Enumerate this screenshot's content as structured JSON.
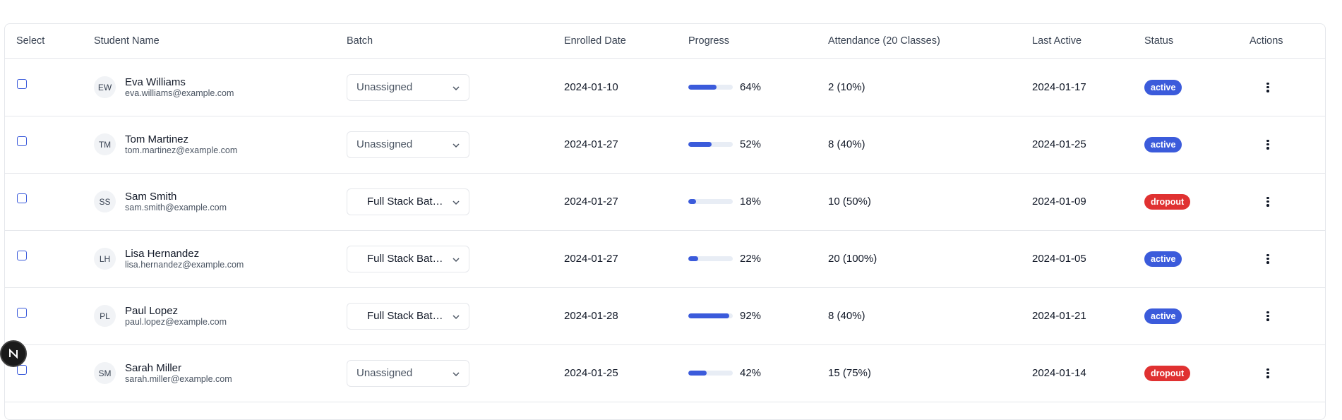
{
  "headers": {
    "select": "Select",
    "student_name": "Student Name",
    "batch": "Batch",
    "enrolled_date": "Enrolled Date",
    "progress": "Progress",
    "attendance": "Attendance (20 Classes)",
    "last_active": "Last Active",
    "status": "Status",
    "actions": "Actions"
  },
  "rows": [
    {
      "initials": "EW",
      "name": "Eva Williams",
      "email": "eva.williams@example.com",
      "batch": "Unassigned",
      "enrolled": "2024-01-10",
      "progress": 64,
      "progress_label": "64%",
      "attendance": "2 (10%)",
      "last_active": "2024-01-17",
      "status": "active"
    },
    {
      "initials": "TM",
      "name": "Tom Martinez",
      "email": "tom.martinez@example.com",
      "batch": "Unassigned",
      "enrolled": "2024-01-27",
      "progress": 52,
      "progress_label": "52%",
      "attendance": "8 (40%)",
      "last_active": "2024-01-25",
      "status": "active"
    },
    {
      "initials": "SS",
      "name": "Sam Smith",
      "email": "sam.smith@example.com",
      "batch": "Full Stack Batch...",
      "enrolled": "2024-01-27",
      "progress": 18,
      "progress_label": "18%",
      "attendance": "10 (50%)",
      "last_active": "2024-01-09",
      "status": "dropout"
    },
    {
      "initials": "LH",
      "name": "Lisa Hernandez",
      "email": "lisa.hernandez@example.com",
      "batch": "Full Stack Batch...",
      "enrolled": "2024-01-27",
      "progress": 22,
      "progress_label": "22%",
      "attendance": "20 (100%)",
      "last_active": "2024-01-05",
      "status": "active"
    },
    {
      "initials": "PL",
      "name": "Paul Lopez",
      "email": "paul.lopez@example.com",
      "batch": "Full Stack Batch...",
      "enrolled": "2024-01-28",
      "progress": 92,
      "progress_label": "92%",
      "attendance": "8 (40%)",
      "last_active": "2024-01-21",
      "status": "active"
    },
    {
      "initials": "SM",
      "name": "Sarah Miller",
      "email": "sarah.miller@example.com",
      "batch": "Unassigned",
      "enrolled": "2024-01-25",
      "progress": 42,
      "progress_label": "42%",
      "attendance": "15 (75%)",
      "last_active": "2024-01-14",
      "status": "dropout"
    }
  ],
  "icons": {
    "dropdown": "chevron-down-icon",
    "actions": "more-vertical-icon",
    "dev_badge": "nextjs-logo-icon"
  },
  "colors": {
    "accent": "#3b5bdb",
    "dropout": "#e03131",
    "progress_track": "#e8edf5"
  }
}
